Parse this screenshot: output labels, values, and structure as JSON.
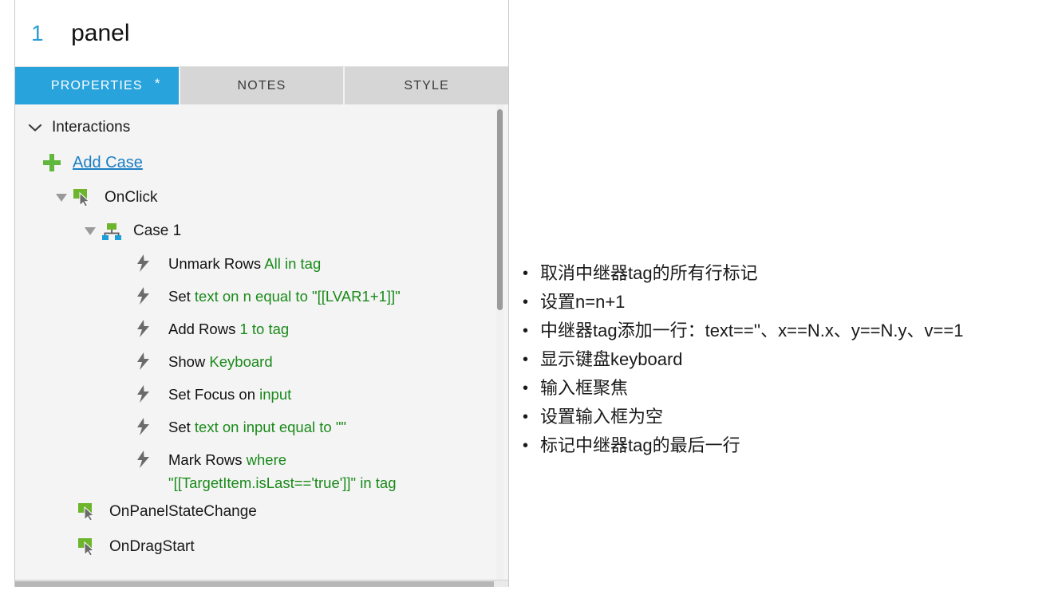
{
  "panel": {
    "header": {
      "object_count": "1",
      "object_name": "panel"
    },
    "tabs": [
      {
        "label": "PROPERTIES",
        "active": true,
        "dirty_marker": "*"
      },
      {
        "label": "NOTES",
        "active": false,
        "dirty_marker": ""
      },
      {
        "label": "STYLE",
        "active": false,
        "dirty_marker": ""
      }
    ],
    "section": {
      "label": "Interactions",
      "chevron": "chevron-down-icon"
    },
    "add_case": {
      "label": "Add Case",
      "icon": "plus-icon"
    },
    "events": [
      {
        "name": "OnClick",
        "icon": "click-event-icon",
        "expanded": true,
        "disclosure": "triangle-down-icon"
      },
      {
        "name": "OnPanelStateChange",
        "icon": "click-event-icon",
        "expanded": false,
        "disclosure": ""
      },
      {
        "name": "OnDragStart",
        "icon": "click-event-icon",
        "expanded": false,
        "disclosure": ""
      }
    ],
    "case": {
      "name": "Case 1",
      "icon": "case-hierarchy-icon",
      "disclosure": "triangle-down-icon"
    },
    "actions": [
      {
        "icon": "lightning-icon",
        "prefix": "Unmark Rows ",
        "param": "All in tag",
        "suffix": "",
        "wrapped": false
      },
      {
        "icon": "lightning-icon",
        "prefix": "Set ",
        "param": "text on n equal to \"[[LVAR1+1]]\"",
        "suffix": "",
        "wrapped": false
      },
      {
        "icon": "lightning-icon",
        "prefix": "Add Rows ",
        "param": "1 to tag",
        "suffix": "",
        "wrapped": false
      },
      {
        "icon": "lightning-icon",
        "prefix": "Show ",
        "param": "Keyboard",
        "suffix": "",
        "wrapped": false
      },
      {
        "icon": "lightning-icon",
        "prefix": "Set Focus on ",
        "param": "input",
        "suffix": "",
        "wrapped": false
      },
      {
        "icon": "lightning-icon",
        "prefix": "Set ",
        "param": "text on input equal to \"\"",
        "suffix": "",
        "wrapped": false
      },
      {
        "icon": "lightning-icon",
        "prefix": "Mark Rows ",
        "param": "where",
        "suffix": "\"[[TargetItem.isLast=='true']]\"  in tag",
        "wrapped": true
      }
    ]
  },
  "notes": {
    "bullet_glyph": "•",
    "items": [
      "取消中继器tag的所有行标记",
      "设置n=n+1",
      "中继器tag添加一行：text==''、x==N.x、y==N.y、v==1",
      "显示键盘keyboard",
      "输入框聚焦",
      "设置输入框为空",
      "标记中继器tag的最后一行"
    ]
  },
  "colors": {
    "tab_active": "#29a3dc",
    "accent_blue": "#1b7fc4",
    "param_green": "#1a8a1a",
    "icon_green": "#6cb52d",
    "plus_green": "#5fb83d",
    "icon_gray": "#666666"
  }
}
